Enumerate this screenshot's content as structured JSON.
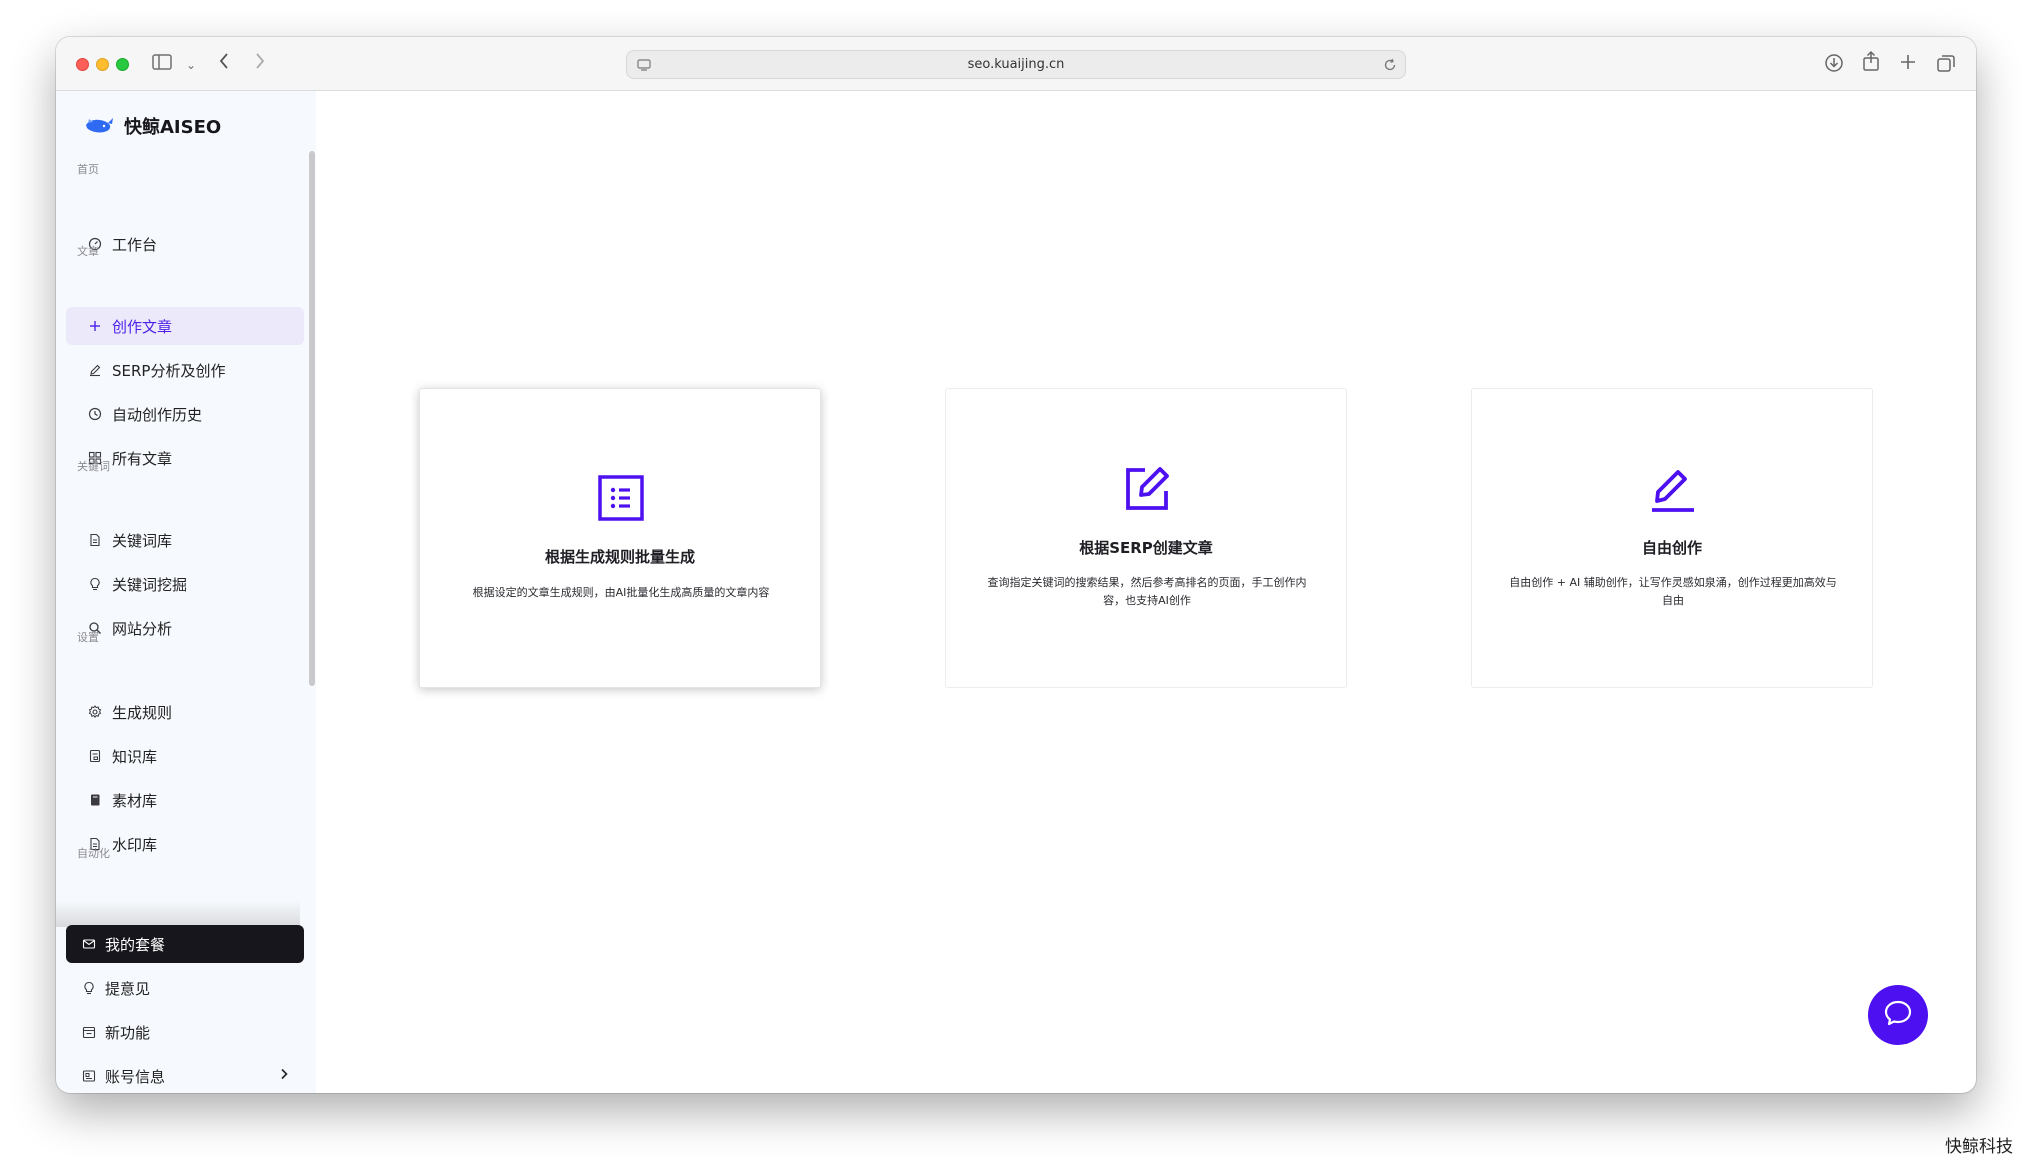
{
  "browser": {
    "url": "seo.kuaijing.cn"
  },
  "brand": {
    "name": "快鲸AISEO"
  },
  "sidebar": {
    "sections": [
      {
        "title": "首页",
        "items": [
          {
            "label": "工作台",
            "icon": "dashboard-icon"
          }
        ]
      },
      {
        "title": "文章",
        "items": [
          {
            "label": "创作文章",
            "icon": "plus-icon",
            "active": true
          },
          {
            "label": "SERP分析及创作",
            "icon": "pen-icon"
          },
          {
            "label": "自动创作历史",
            "icon": "clock-icon"
          },
          {
            "label": "所有文章",
            "icon": "grid-icon"
          }
        ]
      },
      {
        "title": "关键词",
        "items": [
          {
            "label": "关键词库",
            "icon": "file-icon"
          },
          {
            "label": "关键词挖掘",
            "icon": "bulb-icon"
          },
          {
            "label": "网站分析",
            "icon": "search-icon"
          }
        ]
      },
      {
        "title": "设置",
        "items": [
          {
            "label": "生成规则",
            "icon": "gear-icon"
          },
          {
            "label": "知识库",
            "icon": "book-icon"
          },
          {
            "label": "素材库",
            "icon": "stack-icon"
          },
          {
            "label": "水印库",
            "icon": "file-icon"
          }
        ]
      },
      {
        "title": "自动化",
        "items": []
      }
    ],
    "bottom": [
      {
        "label": "我的套餐",
        "icon": "mail-icon"
      },
      {
        "label": "提意见",
        "icon": "bulb-icon"
      },
      {
        "label": "新功能",
        "icon": "calendar-icon"
      },
      {
        "label": "账号信息",
        "icon": "id-card-icon"
      }
    ]
  },
  "cards": [
    {
      "title": "根据生成规则批量生成",
      "desc": "根据设定的文章生成规则，由AI批量化生成高质量的文章内容",
      "icon": "list-icon"
    },
    {
      "title": "根据SERP创建文章",
      "desc": "查询指定关键词的搜索结果，然后参考高排名的页面，手工创作内容，也支持AI创作",
      "icon": "edit-square-icon"
    },
    {
      "title": "自由创作",
      "desc": "自由创作 + AI 辅助创作，让写作灵感如泉涌，创作过程更加高效与自由",
      "icon": "pencil-icon"
    }
  ],
  "colors": {
    "accent": "#4d10f0",
    "sidebar_bg": "#f6f9fd",
    "dark_button": "#16161c"
  },
  "watermark": "快鲸科技"
}
